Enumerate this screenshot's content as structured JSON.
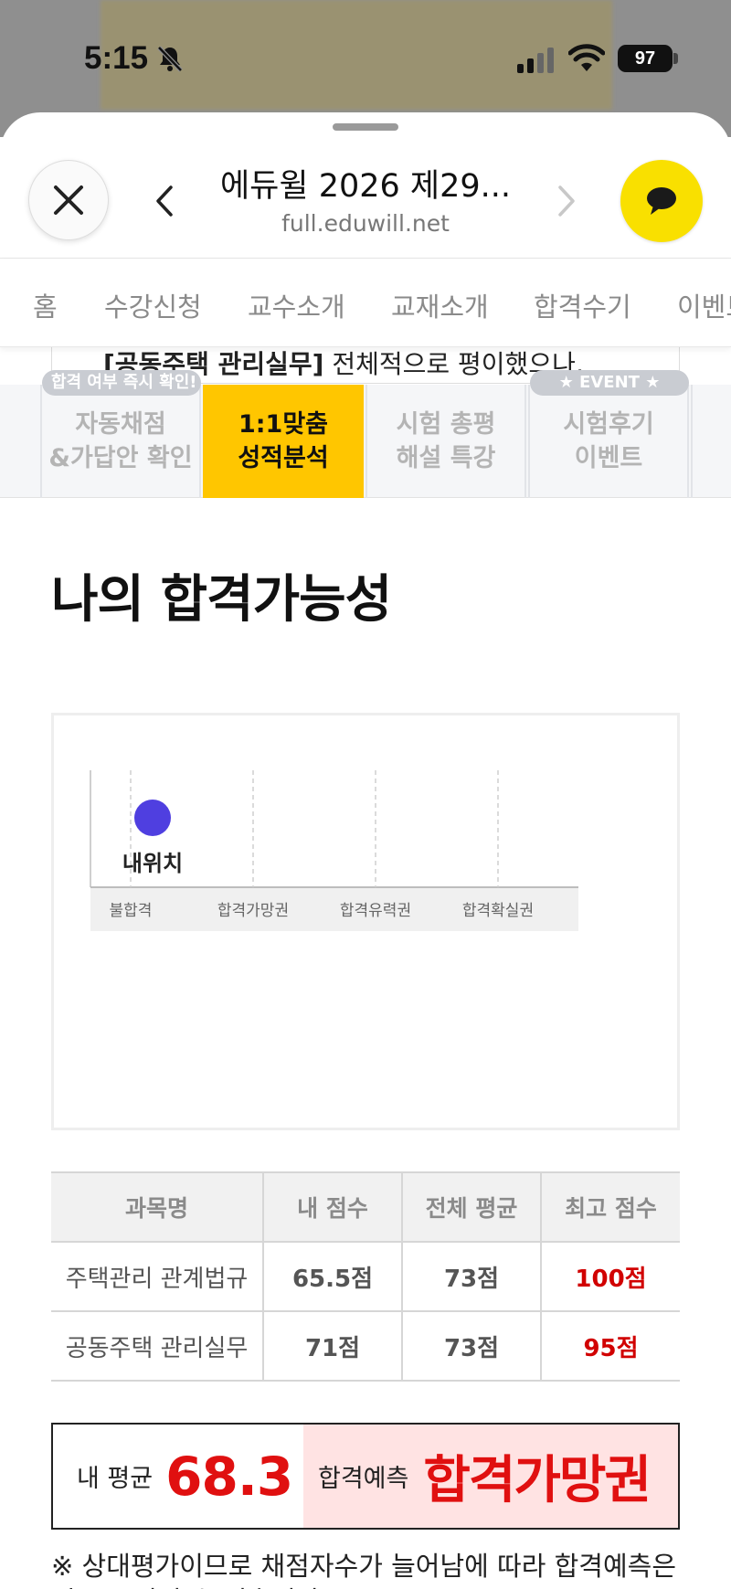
{
  "status_bar": {
    "time": "5:15",
    "battery": "97",
    "icons": [
      "bell-slash-icon",
      "signal-icon",
      "wifi-icon",
      "battery-icon"
    ]
  },
  "browser": {
    "title": "에듀윌 2026 제29...",
    "url": "full.eduwill.net",
    "icons": [
      "close-icon",
      "chevron-left-icon",
      "chevron-right-icon",
      "chat-bubble-icon"
    ],
    "chat_button_color": "#f9e000"
  },
  "nav": {
    "items": [
      "홈",
      "수강신청",
      "교수소개",
      "교재소개",
      "합격수기",
      "이벤트"
    ]
  },
  "peek": {
    "bold": "[공동주택 관리실무]",
    "rest": " 전체적으로 평이했으나,"
  },
  "tabs": [
    {
      "badge": "합격 여부 즉시 확인!",
      "line1": "자동채점",
      "line2": "&가답안 확인"
    },
    {
      "badge": "",
      "line1": "1:1맞춤",
      "line2": "성적분석"
    },
    {
      "badge": "",
      "line1": "시험 총평",
      "line2": "해설 특강"
    },
    {
      "badge": "★ EVENT ★",
      "line1": "시험후기",
      "line2": "이벤트"
    }
  ],
  "accent_color": "#ffc600",
  "section_title": "나의 합격가능성",
  "chart_data": {
    "type": "scatter",
    "categories": [
      "불합격",
      "합격가망권",
      "합격유력권",
      "합격확실권"
    ],
    "marker": {
      "label": "내위치",
      "category": "불합격",
      "color": "#4f3fe0"
    },
    "grid": true
  },
  "score_table": {
    "headers": [
      "과목명",
      "내 점수",
      "전체 평균",
      "최고 점수"
    ],
    "rows": [
      [
        "주택관리 관계법규",
        "65.5점",
        "73점",
        "100점"
      ],
      [
        "공동주택 관리실무",
        "71점",
        "73점",
        "95점"
      ]
    ]
  },
  "result": {
    "avg_label": "내 평균",
    "avg_value": "68.3",
    "pred_label": "합격예측",
    "pred_value": "합격가망권",
    "highlight_color": "#e01010"
  },
  "note": "※ 상대평가이므로 채점자수가 늘어남에 따라 합격예측은 일부 조정될 수 있습니다."
}
